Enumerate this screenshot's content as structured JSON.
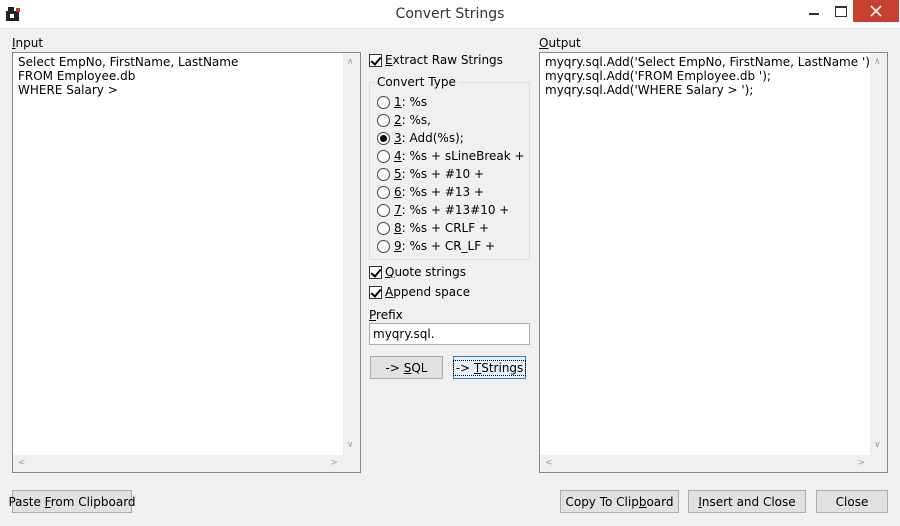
{
  "window": {
    "title": "Convert Strings"
  },
  "input": {
    "label_accel": "I",
    "label_rest": "nput",
    "lines": [
      "Select EmpNo, FirstName, LastName",
      "FROM Employee.db",
      "WHERE Salary >"
    ]
  },
  "output": {
    "label_accel": "O",
    "label_rest": "utput",
    "lines": [
      "myqry.sql.Add('Select EmpNo, FirstName, LastName ');",
      "myqry.sql.Add('FROM Employee.db ');",
      "myqry.sql.Add('WHERE Salary > ');"
    ]
  },
  "options": {
    "extract_raw": {
      "accel": "E",
      "rest": "xtract Raw Strings",
      "checked": true
    },
    "quote_strings": {
      "accel": "Q",
      "rest": "uote strings",
      "checked": true
    },
    "append_space": {
      "accel": "A",
      "rest": "ppend space",
      "checked": true
    }
  },
  "convert_type": {
    "title": "Convert Type",
    "items": [
      {
        "num": "1",
        "text": ": %s",
        "selected": false
      },
      {
        "num": "2",
        "text": ": %s,",
        "selected": false
      },
      {
        "num": "3",
        "text": ": Add(%s);",
        "selected": true
      },
      {
        "num": "4",
        "text": ": %s + sLineBreak +",
        "selected": false
      },
      {
        "num": "5",
        "text": ": %s + #10 +",
        "selected": false
      },
      {
        "num": "6",
        "text": ": %s + #13 +",
        "selected": false
      },
      {
        "num": "7",
        "text": ": %s + #13#10 +",
        "selected": false
      },
      {
        "num": "8",
        "text": ": %s + CRLF +",
        "selected": false
      },
      {
        "num": "9",
        "text": ": %s + CR_LF +",
        "selected": false
      }
    ]
  },
  "prefix": {
    "label_accel": "P",
    "label_rest": "refix",
    "value": "myqry.sql."
  },
  "buttons": {
    "sql": {
      "pre": "-> ",
      "accel": "S",
      "rest": "QL"
    },
    "tstrings": {
      "pre": "-> ",
      "accel": "T",
      "rest": "Strings"
    },
    "paste": {
      "pre": "Paste ",
      "accel": "F",
      "rest": "rom Clipboard"
    },
    "copy": {
      "pre": "Copy To Clip",
      "accel": "b",
      "rest": "oard"
    },
    "insert": {
      "pre": "",
      "accel": "I",
      "rest": "nsert and Close"
    },
    "close": {
      "pre": "",
      "accel": "",
      "rest": "Close"
    }
  }
}
